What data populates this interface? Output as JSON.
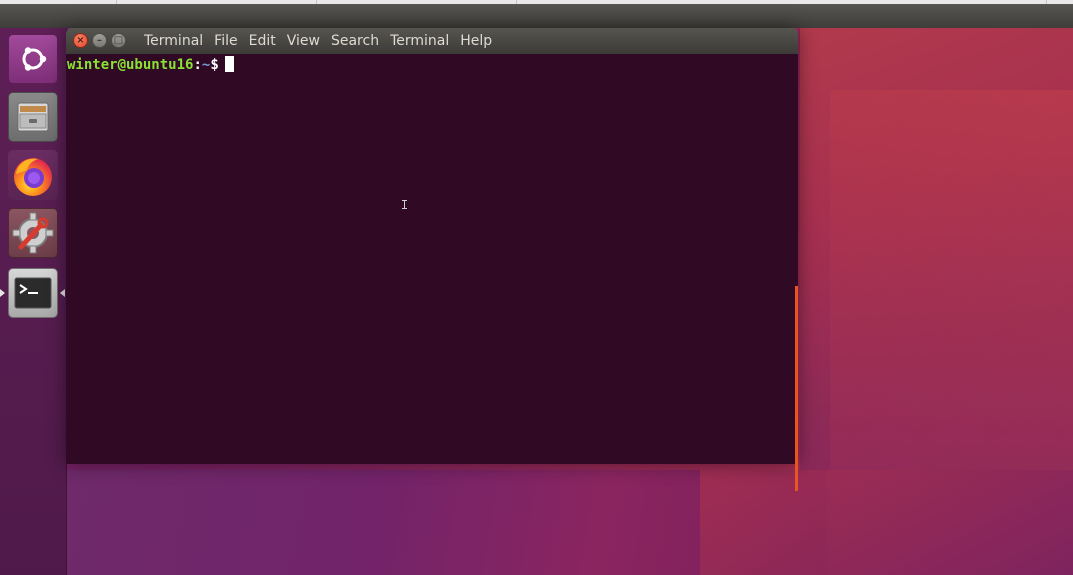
{
  "desktop": {
    "top_panel": {},
    "launcher": {
      "items": [
        {
          "name": "ubuntu-dash",
          "icon": "ubuntu-logo-icon"
        },
        {
          "name": "files",
          "icon": "file-cabinet-icon"
        },
        {
          "name": "firefox",
          "icon": "firefox-icon"
        },
        {
          "name": "system-settings",
          "icon": "settings-gear-wrench-icon"
        },
        {
          "name": "terminal",
          "icon": "terminal-icon",
          "active": true
        }
      ]
    }
  },
  "terminal": {
    "menu": [
      "Terminal",
      "File",
      "Edit",
      "View",
      "Search",
      "Terminal",
      "Help"
    ],
    "prompt": {
      "user_host": "winter@ubuntu16",
      "colon": ":",
      "path": "~",
      "symbol": "$"
    },
    "colors": {
      "background": "#300a24",
      "user_host": "#8ae234",
      "path": "#729fcf",
      "accent": "#e95420"
    }
  }
}
